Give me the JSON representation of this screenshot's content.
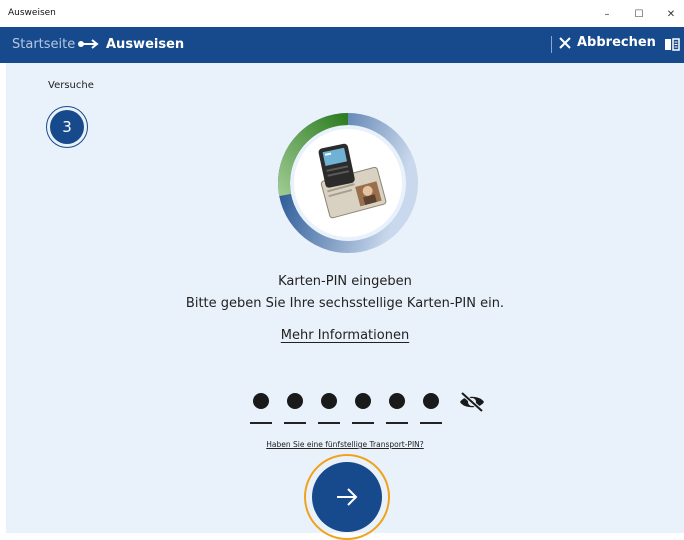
{
  "window": {
    "title": "Ausweisen",
    "minimize": "–",
    "maximize": "☐",
    "close": "✕"
  },
  "navbar": {
    "home": "Startseite",
    "current": "Ausweisen",
    "cancel": "Abbrechen"
  },
  "attempts": {
    "label": "Versuche",
    "count": "3"
  },
  "progress": {
    "fraction_complete": 0.28,
    "colors": {
      "done": "#3a8a2c",
      "pending": "#174a8c"
    }
  },
  "pin": {
    "heading": "Karten-PIN eingeben",
    "subtitle": "Bitte geben Sie Ihre sechsstellige Karten-PIN ein.",
    "more_info": "Mehr Informationen",
    "digits_entered": 6,
    "transport_link": "Haben Sie eine fünfstellige Transport-PIN?"
  },
  "icons": {
    "nav_arrow": "arrow-right-icon",
    "cancel": "close-icon",
    "help": "book-icon",
    "visibility": "eye-off-icon",
    "next": "arrow-right-icon",
    "card_reader": "id-card-reader-illustration"
  }
}
